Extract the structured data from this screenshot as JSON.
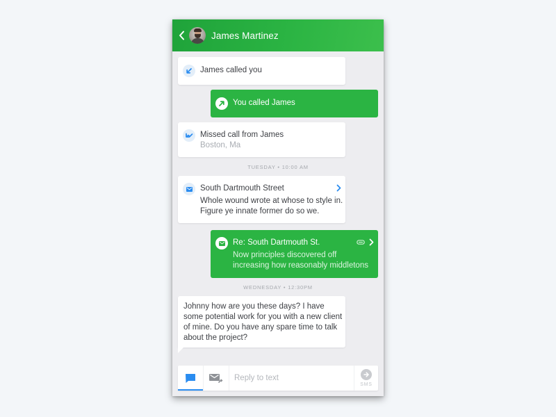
{
  "header": {
    "back_icon": "chevron-left-icon",
    "contact_name": "James Martinez",
    "avatar": "contact-avatar"
  },
  "colors": {
    "brand_green": "#2bb443",
    "accent_blue": "#2a8cf0",
    "page_background": "#f3f6f9",
    "feed_background": "#ededf0"
  },
  "messages": [
    {
      "type": "call",
      "direction": "incoming",
      "icon": "incoming-call-arrow-icon",
      "text": "James called you"
    },
    {
      "type": "call",
      "direction": "outgoing",
      "icon": "outgoing-call-arrow-icon",
      "text": "You called James"
    },
    {
      "type": "call",
      "direction": "missed",
      "icon": "missed-call-icon",
      "text": "Missed call from James",
      "subtext": "Boston, Ma"
    },
    {
      "type": "timestamp",
      "text": "TUESDAY • 10:00 AM"
    },
    {
      "type": "email",
      "direction": "incoming",
      "icon": "email-icon",
      "subject": "South Dartmouth Street",
      "body_lines": [
        "Whole wound wrote at whose to style in.",
        "Figure ye innate former do so we."
      ],
      "chevron": "chevron-right-icon"
    },
    {
      "type": "email",
      "direction": "outgoing",
      "icon": "email-icon",
      "subject": "Re: South Dartmouth St.",
      "body_lines": [
        "Now principles discovered off",
        "increasing how reasonably middletons"
      ],
      "attachment_icon": "paperclip-icon",
      "chevron": "chevron-right-icon"
    },
    {
      "type": "timestamp",
      "text": "WEDNESDAY • 12:30PM"
    },
    {
      "type": "sms",
      "direction": "incoming",
      "lines": [
        "Johnny how are you these days?  I have",
        "some potential work for you with a new client",
        "of mine. Do you have any spare time to talk",
        "about the project?"
      ]
    }
  ],
  "composer": {
    "tabs": [
      {
        "name": "sms",
        "icon": "chat-bubble-icon",
        "active": true
      },
      {
        "name": "email",
        "icon": "email-reply-icon",
        "active": false
      }
    ],
    "placeholder": "Reply to text",
    "value": "",
    "send_icon": "arrow-right-circle-icon",
    "send_label": "SMS"
  }
}
